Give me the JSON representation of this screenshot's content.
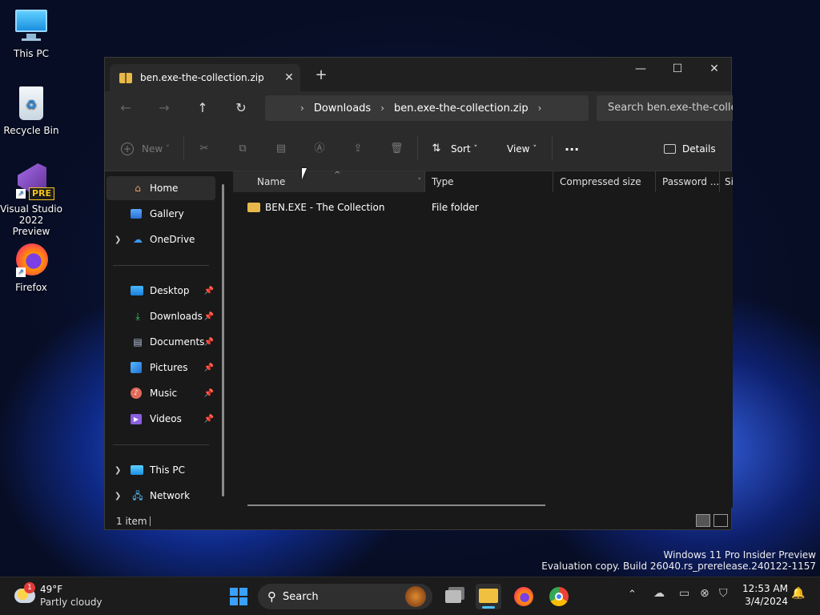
{
  "desktop": {
    "icons": [
      {
        "label": "This PC"
      },
      {
        "label": "Recycle Bin"
      },
      {
        "label": "Visual Studio 2022 Preview"
      },
      {
        "label": "Firefox"
      }
    ],
    "vs_badge": "PRE"
  },
  "window": {
    "tab_title": "ben.exe-the-collection.zip",
    "breadcrumbs": [
      "Downloads",
      "ben.exe-the-collection.zip"
    ],
    "search_placeholder": "Search ben.exe-the-collection.zip",
    "toolbar": {
      "new_label": "New",
      "sort_label": "Sort",
      "view_label": "View",
      "details_label": "Details"
    },
    "nav": {
      "home": "Home",
      "gallery": "Gallery",
      "onedrive": "OneDrive",
      "desktop": "Desktop",
      "downloads": "Downloads",
      "documents": "Documents",
      "pictures": "Pictures",
      "music": "Music",
      "videos": "Videos",
      "thispc": "This PC",
      "network": "Network"
    },
    "columns": {
      "name": "Name",
      "type": "Type",
      "compressed": "Compressed size",
      "password": "Password ...",
      "size": "Si"
    },
    "rows": [
      {
        "name": "BEN.EXE - The Collection",
        "type": "File folder"
      }
    ],
    "status": "1 item"
  },
  "watermark": {
    "line1": "Windows 11 Pro Insider Preview",
    "line2": "Evaluation copy. Build 26040.rs_prerelease.240122-1157"
  },
  "taskbar": {
    "weather_temp": "49°F",
    "weather_desc": "Partly cloudy",
    "weather_badge": "1",
    "search_label": "Search",
    "time": "12:53 AM",
    "date": "3/4/2024"
  }
}
